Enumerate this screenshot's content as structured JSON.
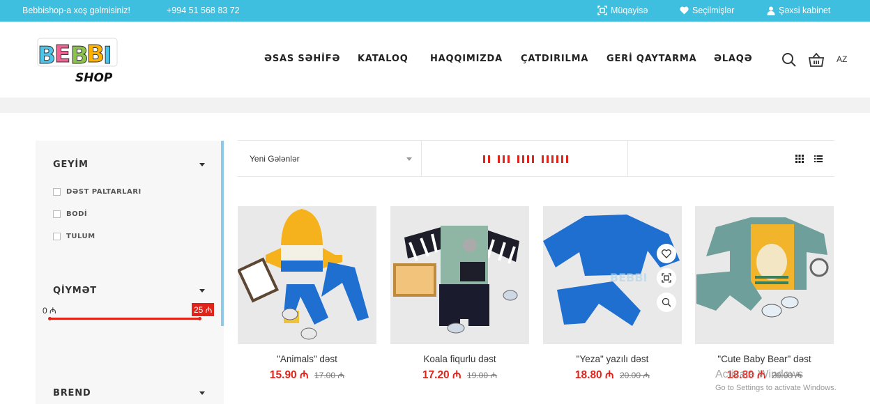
{
  "topbar": {
    "welcome": "Bebbishop-a xoş gəlmisiniz!",
    "phone": "+994 51 568 83 72",
    "compare": "Müqayisə",
    "favorites": "Seçilmişlər",
    "account": "Şəxsi kabinet"
  },
  "logo": {
    "text": "BEBBI",
    "sub": "SHOP"
  },
  "nav": [
    "ƏSAS SƏHİFƏ",
    "KATALOQ",
    "HAQQIMIZDA",
    "ÇATDIRILMA",
    "GERİ QAYTARMA",
    "ƏLAQƏ"
  ],
  "lang": "AZ",
  "sidebar": {
    "clothing_title": "GEYİM",
    "clothing_items": [
      "DƏST PALTARLARI",
      "BODİ",
      "TULUM"
    ],
    "price_title": "QİYMƏT",
    "price_min": "0 ₼",
    "price_max": "25 ₼",
    "price_range": [
      0,
      25
    ],
    "brand_title": "BREND"
  },
  "toolbar": {
    "sort_label": "Yeni Gələnlər",
    "per_page_bars": [
      2,
      3,
      4,
      6
    ],
    "colors": {
      "accent": "#e2231a",
      "topbar": "#3fbfdf"
    }
  },
  "products": [
    {
      "name": "\"Animals\" dəst",
      "price": "15.90 ₼",
      "old_price": "17.00 ₼"
    },
    {
      "name": "Koala fiqurlu dəst",
      "price": "17.20 ₼",
      "old_price": "19.00 ₼"
    },
    {
      "name": "\"Yeza\" yazılı dəst",
      "price": "18.80 ₼",
      "old_price": "20.00 ₼"
    },
    {
      "name": "\"Cute Baby Bear\" dəst",
      "price": "18.80 ₼",
      "old_price": "20.00 ₼"
    }
  ],
  "watermark": {
    "title": "Activate Windows",
    "sub": "Go to Settings to activate Windows."
  }
}
